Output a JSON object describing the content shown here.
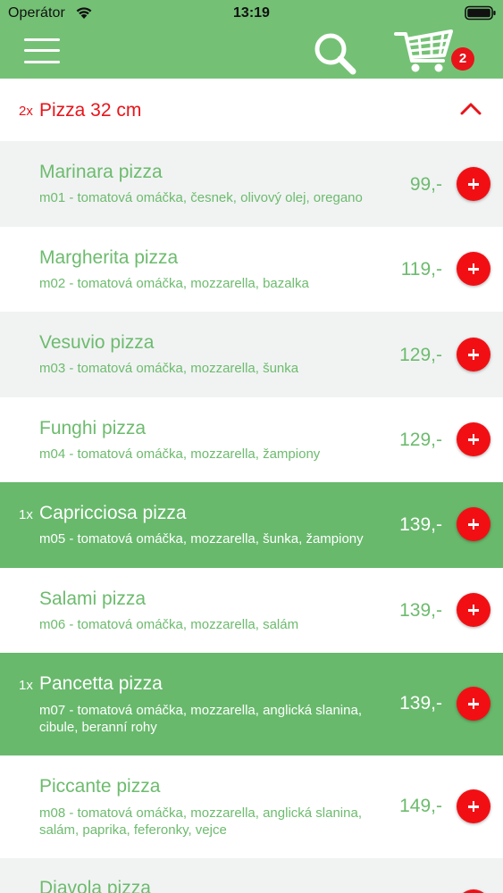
{
  "status_bar": {
    "carrier": "Operátor",
    "time": "13:19"
  },
  "nav": {
    "menu_icon": "hamburger-menu-icon",
    "search_icon": "search-icon",
    "cart_icon": "shopping-cart-icon",
    "cart_count": "2"
  },
  "category": {
    "qty": "2x",
    "title": "Pizza 32 cm",
    "expanded": true
  },
  "colors": {
    "header_green": "#74c175",
    "selected_row": "#68b96c",
    "text_green": "#6dbb6e",
    "accent_red": "#e8141a",
    "alt_row": "#f1f3f3"
  },
  "products": [
    {
      "qty": "",
      "name": "Marinara pizza",
      "desc": "m01 - tomatová omáčka, česnek, olivový olej, oregano",
      "price": "99,-",
      "selected": false
    },
    {
      "qty": "",
      "name": "Margherita pizza",
      "desc": "m02 - tomatová omáčka, mozzarella, bazalka",
      "price": "119,-",
      "selected": false
    },
    {
      "qty": "",
      "name": "Vesuvio pizza",
      "desc": "m03 - tomatová omáčka, mozzarella, šunka",
      "price": "129,-",
      "selected": false
    },
    {
      "qty": "",
      "name": "Funghi pizza",
      "desc": "m04 - tomatová omáčka, mozzarella, žampiony",
      "price": "129,-",
      "selected": false
    },
    {
      "qty": "1x",
      "name": "Capricciosa pizza",
      "desc": "m05 - tomatová omáčka, mozzarella, šunka, žampiony",
      "price": "139,-",
      "selected": true
    },
    {
      "qty": "",
      "name": "Salami pizza",
      "desc": "m06 - tomatová omáčka, mozzarella, salám",
      "price": "139,-",
      "selected": false
    },
    {
      "qty": "1x",
      "name": "Pancetta pizza",
      "desc": "m07 - tomatová omáčka, mozzarella, anglická slanina, cibule, beranní rohy",
      "price": "139,-",
      "selected": true
    },
    {
      "qty": "",
      "name": "Piccante pizza",
      "desc": "m08 - tomatová omáčka, mozzarella, anglická slanina, salám, paprika, feferonky, vejce",
      "price": "149,-",
      "selected": false
    },
    {
      "qty": "",
      "name": "Diavola pizza",
      "desc": "",
      "price": "",
      "selected": false
    }
  ]
}
